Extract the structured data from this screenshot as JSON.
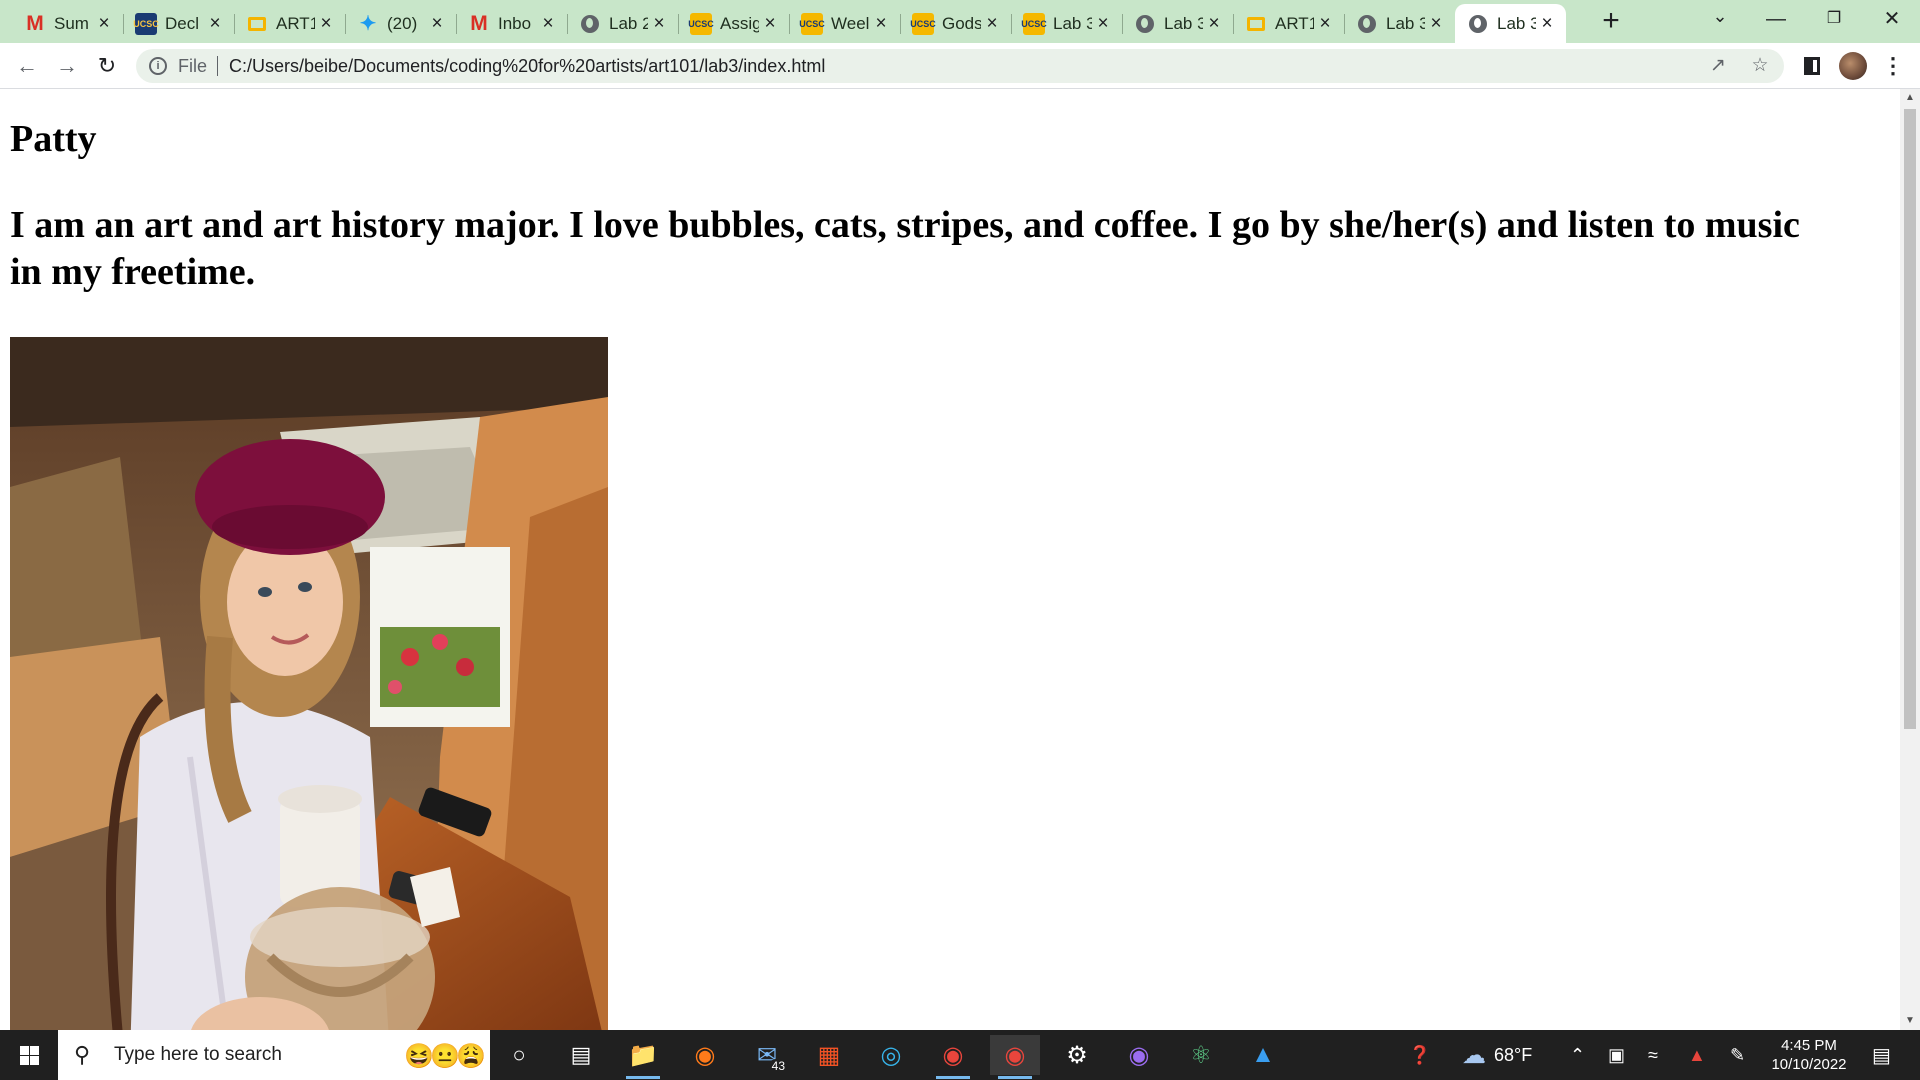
{
  "browser": {
    "tabs": [
      {
        "title": "Sum",
        "icon": "gmail-icon",
        "active": false
      },
      {
        "title": "Decl",
        "icon": "ucsc-icon",
        "active": false
      },
      {
        "title": "ART1",
        "icon": "google-slides-icon",
        "active": false
      },
      {
        "title": "(20)",
        "icon": "twitter-icon",
        "active": false
      },
      {
        "title": "Inbo",
        "icon": "gmail-icon",
        "active": false
      },
      {
        "title": "Lab 2",
        "icon": "globe-icon",
        "active": false
      },
      {
        "title": "Assig",
        "icon": "ucsc-icon",
        "active": false
      },
      {
        "title": "Weel",
        "icon": "ucsc-icon",
        "active": false
      },
      {
        "title": "Gods",
        "icon": "ucsc-icon",
        "active": false
      },
      {
        "title": "Lab 3",
        "icon": "ucsc-icon",
        "active": false
      },
      {
        "title": "Lab 3",
        "icon": "globe-icon",
        "active": false
      },
      {
        "title": "ART1",
        "icon": "google-slides-icon",
        "active": false
      },
      {
        "title": "Lab 3",
        "icon": "globe-icon",
        "active": false
      },
      {
        "title": "Lab 3",
        "icon": "globe-icon",
        "active": true
      }
    ],
    "new_tab_label": "+",
    "address_bar": {
      "scheme_label": "File",
      "url": "C:/Users/beibe/Documents/coding%20for%20artists/art101/lab3/index.html"
    }
  },
  "page": {
    "heading": "Patty",
    "bio": "I am an art and art history major. I love bubbles, cats, stripes, and coffee. I go by she/her(s) and listen to music in my freetime.",
    "photo_alt": "Patty in a burgundy beret holding iced coffee in a cafe"
  },
  "taskbar": {
    "search_placeholder": "Type here to search",
    "mail_badge": "43",
    "weather_temp": "68°F",
    "time": "4:45 PM",
    "date": "10/10/2022"
  },
  "colors": {
    "tabstrip_bg": "#c8e6c9",
    "omnibox_bg": "#eaf1ea",
    "taskbar_bg": "#202020"
  }
}
